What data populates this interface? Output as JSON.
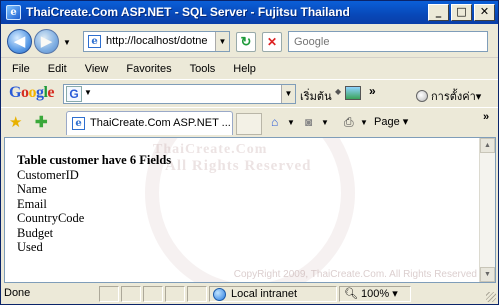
{
  "window": {
    "title": "ThaiCreate.Com ASP.NET - SQL Server - Fujitsu Thailand",
    "minimize": "_",
    "maximize": "□",
    "close": "✕"
  },
  "address": {
    "url": "http://localhost/dotne",
    "search_placeholder": "Google"
  },
  "menu": [
    "File",
    "Edit",
    "View",
    "Favorites",
    "Tools",
    "Help"
  ],
  "google_toolbar": {
    "logo": [
      "G",
      "o",
      "o",
      "g",
      "l",
      "e"
    ],
    "search_button": "เริ่มต้น",
    "settings": "การตั้งค่า",
    "more": "»"
  },
  "tabbar": {
    "tab_title": "ThaiCreate.Com ASP.NET ...",
    "page_menu": "Page",
    "more": "»"
  },
  "content": {
    "heading": "Table customer have 6 Fields",
    "fields": [
      "CustomerID",
      "Name",
      "Email",
      "CountryCode",
      "Budget",
      "Used"
    ],
    "watermark_line1": "ThaiCreate.Com",
    "watermark_line2": "All Rights Reserved",
    "watermark_copyright": "CopyRight 2009, ThaiCreate.Com. All Rights Reserved"
  },
  "status": {
    "left": "Done",
    "zone": "Local intranet",
    "zoom": "100%"
  },
  "icons": {
    "back": "back-arrow-icon",
    "forward": "forward-arrow-icon",
    "refresh": "refresh-icon",
    "stop": "stop-icon",
    "favorites": "star-icon",
    "add_favorite": "add-favorite-icon",
    "home": "home-icon",
    "feeds": "rss-feed-icon",
    "print": "printer-icon",
    "zone": "globe-icon"
  }
}
